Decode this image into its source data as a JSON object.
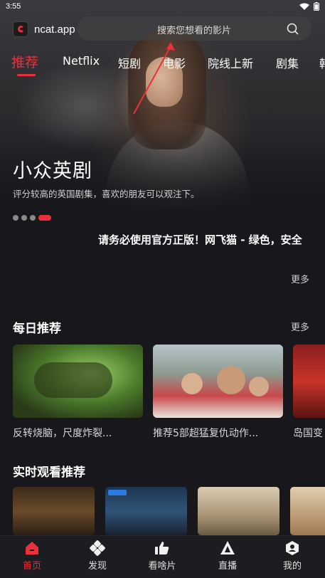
{
  "status": {
    "time": "3:55"
  },
  "app": {
    "name": "ncat.app"
  },
  "search": {
    "placeholder": "搜索您想看的影片"
  },
  "tabs": [
    {
      "label": "推荐",
      "active": true
    },
    {
      "label": "Netflix"
    },
    {
      "label": "短剧"
    },
    {
      "label": "电影"
    },
    {
      "label": "院线上新"
    },
    {
      "label": "剧集"
    },
    {
      "label": "韩"
    }
  ],
  "hero": {
    "title": "小众英剧",
    "subtitle": "评分较高的英国剧集，喜欢的朋友可以观注下。",
    "dots_count": 4,
    "active_dot": 3
  },
  "notice": {
    "text": "请务必使用官方正版！网飞猫 - 绿色，安全"
  },
  "notice_more": "更多",
  "daily": {
    "title": "每日推荐",
    "more": "更多",
    "items": [
      {
        "caption": "反转烧脑，尺度炸裂..."
      },
      {
        "caption": "推荐5部超猛复仇动作..."
      },
      {
        "caption": "岛国变"
      }
    ]
  },
  "realtime": {
    "title": "实时观看推荐"
  },
  "bottom_nav": [
    {
      "label": "首页",
      "icon": "home-icon",
      "active": true
    },
    {
      "label": "发现",
      "icon": "discover-icon"
    },
    {
      "label": "看啥片",
      "icon": "thumbs-up-icon"
    },
    {
      "label": "直播",
      "icon": "live-icon"
    },
    {
      "label": "我的",
      "icon": "profile-icon"
    }
  ],
  "colors": {
    "accent": "#e8313a",
    "background": "#17171c"
  }
}
